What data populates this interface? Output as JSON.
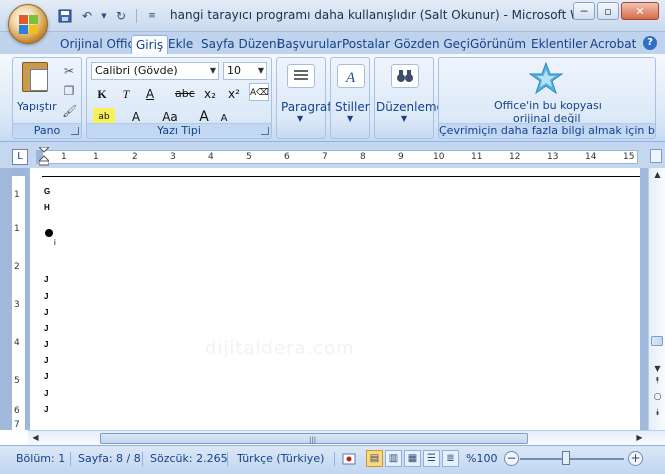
{
  "title_bar": {
    "window_title": "hangi tarayıcı programı daha kullanışlıdır (Salt Okunur) - Microsoft W...",
    "minimize": "─",
    "restore": "▫",
    "close": "✕"
  },
  "tabs": [
    "Orijinal Offic",
    "Giriş",
    "Ekle",
    "Sayfa Düzeni",
    "Başvurular",
    "Postalar",
    "Gözden Geçi",
    "Görünüm",
    "Eklentiler",
    "Acrobat"
  ],
  "help": "?",
  "ribbon": {
    "clipboard": {
      "paste_label": "Yapıştır",
      "group_label": "Pano"
    },
    "font": {
      "font_name": "Calibri (Gövde)",
      "font_size": "10",
      "bold": "K",
      "italic": "T",
      "underline": "A",
      "strikethrough": "abc",
      "subscript": "x₂",
      "superscript": "x²",
      "change_case": "Aa",
      "grow_font": "A",
      "shrink_font": "A",
      "group_label": "Yazı Tipi"
    },
    "paragraph_label": "Paragraf",
    "styles_label": "Stiller",
    "editing_label": "Düzenleme",
    "genuine": {
      "line1": "Office'in bu kopyası",
      "line2": "orijinal değil",
      "group_label": "Çevrimiçin daha fazla bilgi almak için b..."
    }
  },
  "ruler": {
    "numbers": [
      "1",
      "1",
      "2",
      "3",
      "4",
      "5",
      "6",
      "7",
      "8",
      "9",
      "10",
      "11",
      "12",
      "13",
      "14",
      "15"
    ],
    "v_numbers": [
      "1",
      "1",
      "2",
      "3",
      "4",
      "5",
      "6",
      "7"
    ]
  },
  "document": {
    "lines": [
      "G",
      "H",
      "i",
      "J",
      "J",
      "J",
      "J",
      "J",
      "J",
      "J",
      "J",
      "J"
    ],
    "watermark": "dijitaldera.com"
  },
  "status_bar": {
    "section": "Bölüm: 1",
    "page": "Sayfa: 8 / 8",
    "words": "Sözcük: 2.265",
    "language": "Türkçe (Türkiye)",
    "zoom": "%100",
    "zoom_level": 0.5
  }
}
